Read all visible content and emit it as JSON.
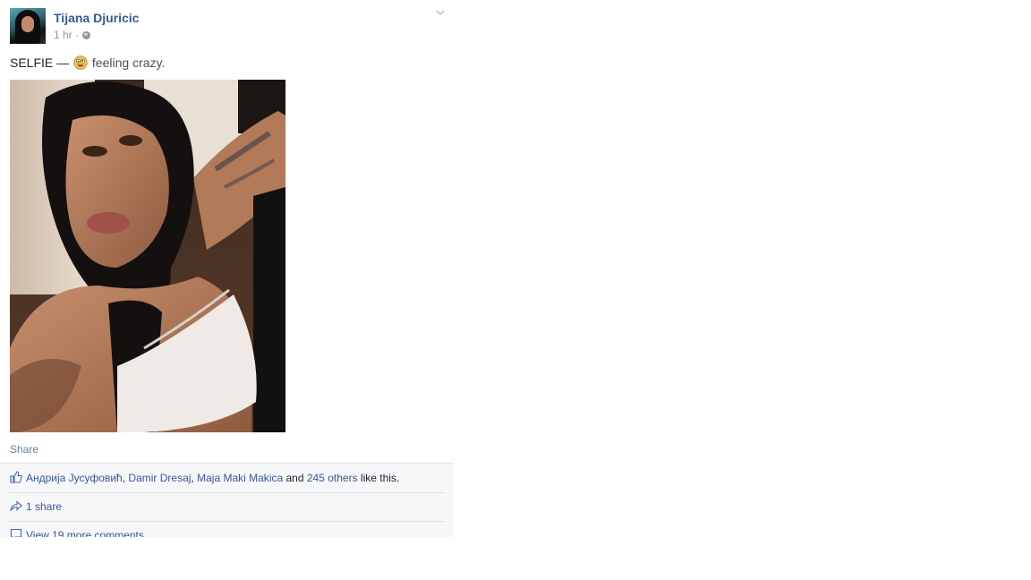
{
  "post": {
    "author": "Tijana Djuricic",
    "timestamp": "1 hr",
    "meta_separator": "·",
    "privacy_icon": "globe-icon",
    "menu_icon": "chevron-down-icon",
    "status_text": "SELFIE",
    "status_dash": "—",
    "feeling_icon": "crazy-face-emoji",
    "feeling_text": "feeling crazy.",
    "share_label": "Share"
  },
  "likes": {
    "names": [
      "Андрија Јусуфовић",
      "Damir Dresaj",
      "Maja Maki Makica"
    ],
    "sep": ",",
    "and_text": "and",
    "others_link": "245 others",
    "suffix": "like this."
  },
  "shares": {
    "label": "1 share"
  },
  "comments": {
    "label": "View 19 more comments"
  }
}
